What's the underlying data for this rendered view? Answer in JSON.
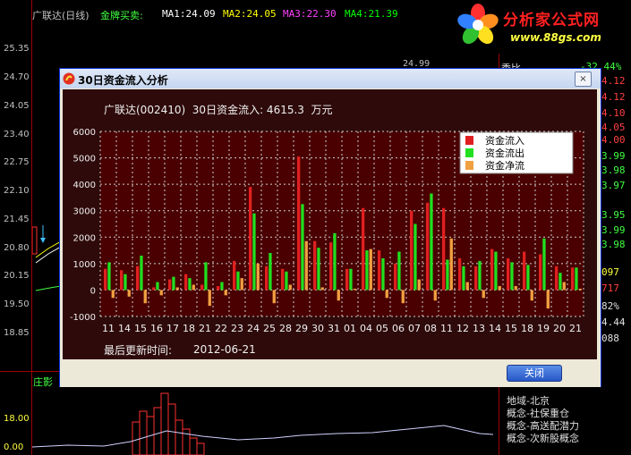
{
  "background": {
    "header": {
      "stock": "广联达(日线)",
      "indicator": "金牌买卖:",
      "ma": [
        {
          "label": "MA1:24.09",
          "color": "#ffffff"
        },
        {
          "label": "MA2:24.05",
          "color": "#ffff00"
        },
        {
          "label": "MA3:22.30",
          "color": "#ff40ff"
        },
        {
          "label": "MA4:21.39",
          "color": "#00ff00"
        }
      ]
    },
    "price_axis": [
      "25.35",
      "24.70",
      "24.05",
      "23.40",
      "22.75",
      "22.10",
      "21.45",
      "20.80",
      "20.15",
      "19.50",
      "18.85"
    ],
    "price_tag": "24.99",
    "lower_panel_label": "庄影",
    "lower_axis": [
      "18.00",
      "0.00"
    ],
    "right_panel": {
      "weibi_label": "委比",
      "weibi_value": "-32.44%",
      "values": [
        "4.12",
        "4.12",
        "4.10",
        "4.05",
        "4.00",
        "3.99",
        "3.98",
        "3.97",
        "3.95",
        "3.99",
        "3.98",
        "097",
        "717",
        "82%",
        "4.44",
        "088"
      ],
      "concepts": [
        "地域-北京",
        "概念-社保重仓",
        "概念-高送配潜力",
        "概念-次新股概念"
      ]
    },
    "logo": {
      "name": "分析家公式网",
      "url": "www.88gs.com"
    }
  },
  "dialog": {
    "title": "30日资金流入分析",
    "close_label": "×",
    "chart_heading": "广联达(002410)  30日资金流入: 4615.3  万元",
    "update_label": "最后更新时间:",
    "update_date": "2012-06-21",
    "ok_label": "关闭"
  },
  "chart_data": {
    "type": "bar",
    "ylim": [
      -1000,
      6000
    ],
    "yticks": [
      "6000",
      "5000",
      "4000",
      "3000",
      "2000",
      "1000",
      "0",
      "-1000"
    ],
    "categories": [
      "11",
      "14",
      "15",
      "16",
      "17",
      "18",
      "21",
      "22",
      "23",
      "24",
      "25",
      "28",
      "29",
      "30",
      "31",
      "01",
      "04",
      "05",
      "06",
      "07",
      "08",
      "11",
      "12",
      "13",
      "14",
      "15",
      "18",
      "19",
      "20",
      "21"
    ],
    "series": [
      {
        "name": "资金流入",
        "color": "#e02020",
        "values": [
          800,
          750,
          900,
          100,
          400,
          600,
          200,
          150,
          1100,
          3900,
          900,
          800,
          5050,
          1850,
          1800,
          800,
          3100,
          1500,
          1000,
          3000,
          3300,
          3100,
          1200,
          900,
          1550,
          1200,
          1450,
          1350,
          900,
          850
        ]
      },
      {
        "name": "资金流出",
        "color": "#20e020",
        "values": [
          1050,
          600,
          1300,
          300,
          500,
          450,
          1050,
          300,
          700,
          2900,
          1400,
          700,
          3250,
          1600,
          2150,
          800,
          1500,
          1200,
          1450,
          2500,
          3650,
          1150,
          900,
          1100,
          1450,
          1050,
          950,
          1950,
          650,
          850
        ]
      },
      {
        "name": "资金净流",
        "color": "#f0a040",
        "values": [
          -300,
          -250,
          -500,
          -200,
          100,
          200,
          -600,
          -200,
          450,
          1000,
          -500,
          200,
          1850,
          100,
          -400,
          50,
          1550,
          -300,
          -500,
          400,
          -400,
          1950,
          300,
          -300,
          150,
          150,
          -400,
          -700,
          300,
          50
        ]
      }
    ],
    "grid": true,
    "legend": "top-right"
  }
}
